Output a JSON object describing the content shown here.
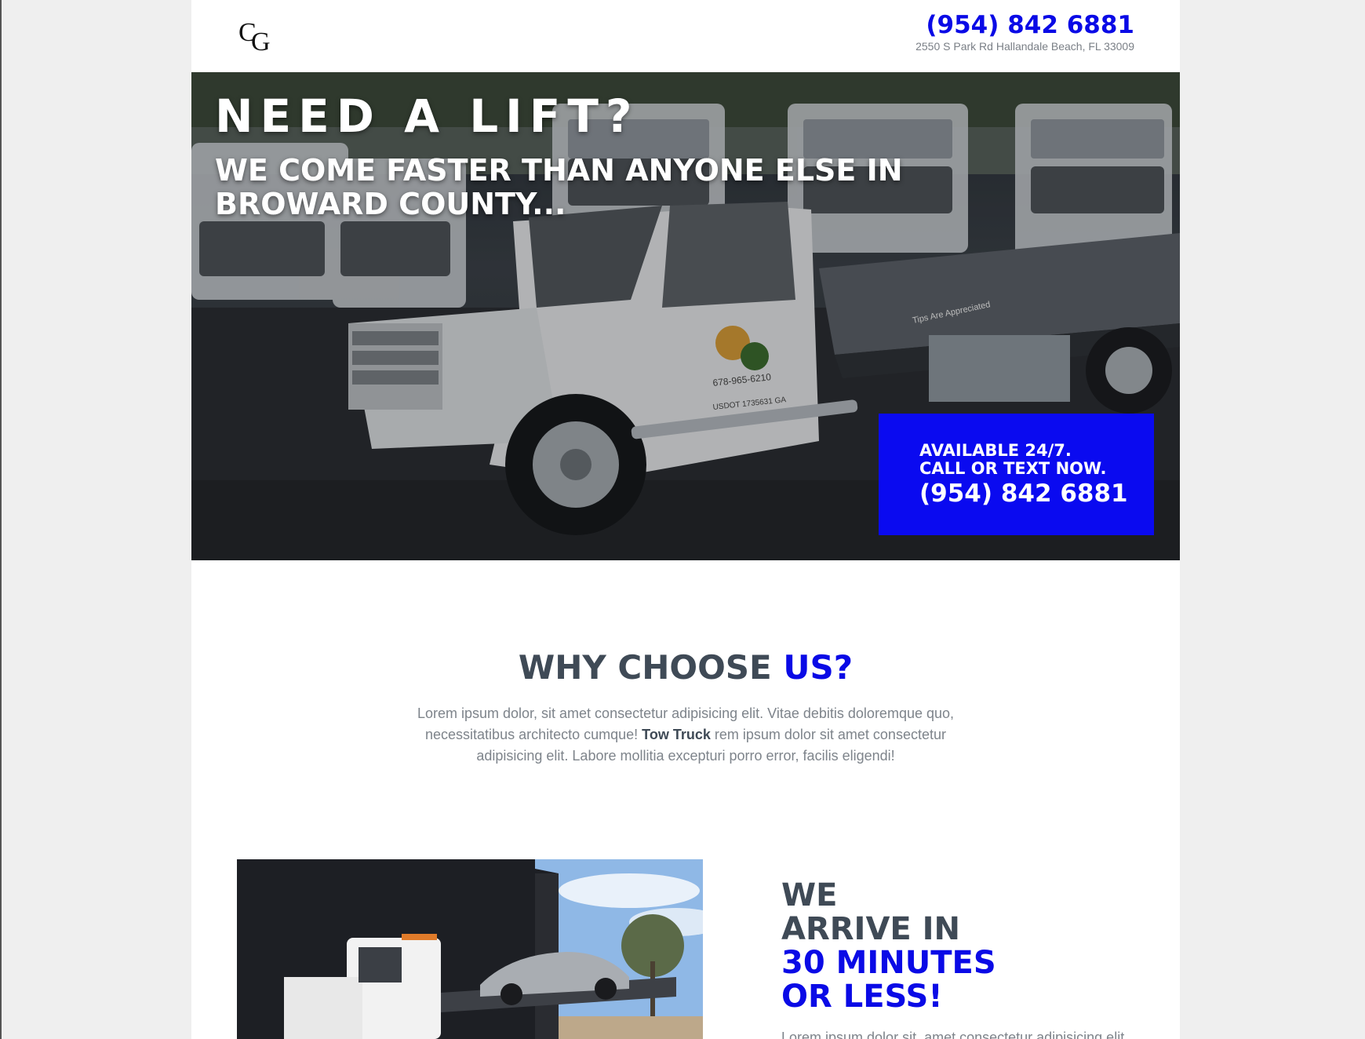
{
  "header": {
    "logo_alt": "CG",
    "phone": "(954) 842 6881",
    "address": "2550 S Park Rd Hallandale Beach, FL 33009"
  },
  "hero": {
    "title": "NEED A LIFT?",
    "subtitle": "WE COME FASTER THAN ANYONE ELSE IN BROWARD COUNTY...",
    "truck_phone_decal": "678-965-6210",
    "truck_usdot_decal": "USDOT 1735631 GA",
    "truck_bed_decal": "Tips Are Appreciated",
    "cta": {
      "line1": "AVAILABLE 24/7.",
      "line2": "CALL OR TEXT NOW.",
      "phone": "(954) 842 6881"
    }
  },
  "why": {
    "title_main": "WHY CHOOSE",
    "title_accent": "US?",
    "text_before": "Lorem ipsum dolor, sit amet consectetur adipisicing elit. Vitae debitis doloremque quo, necessitatibus architecto cumque! ",
    "text_bold": "Tow Truck",
    "text_after": " rem ipsum dolor sit amet consectetur adipisicing elit. Labore mollitia excepturi porro error, facilis eligendi!"
  },
  "feature": {
    "title_line1": "WE",
    "title_line2": "ARRIVE IN",
    "title_accent1": "30 MINUTES",
    "title_accent2": "OR LESS!",
    "text": "Lorem ipsum dolor sit, amet consectetur adipisicing elit"
  },
  "colors": {
    "accent": "#0a0ae6",
    "heading": "#3f4a56",
    "body_text": "#7e848b"
  }
}
